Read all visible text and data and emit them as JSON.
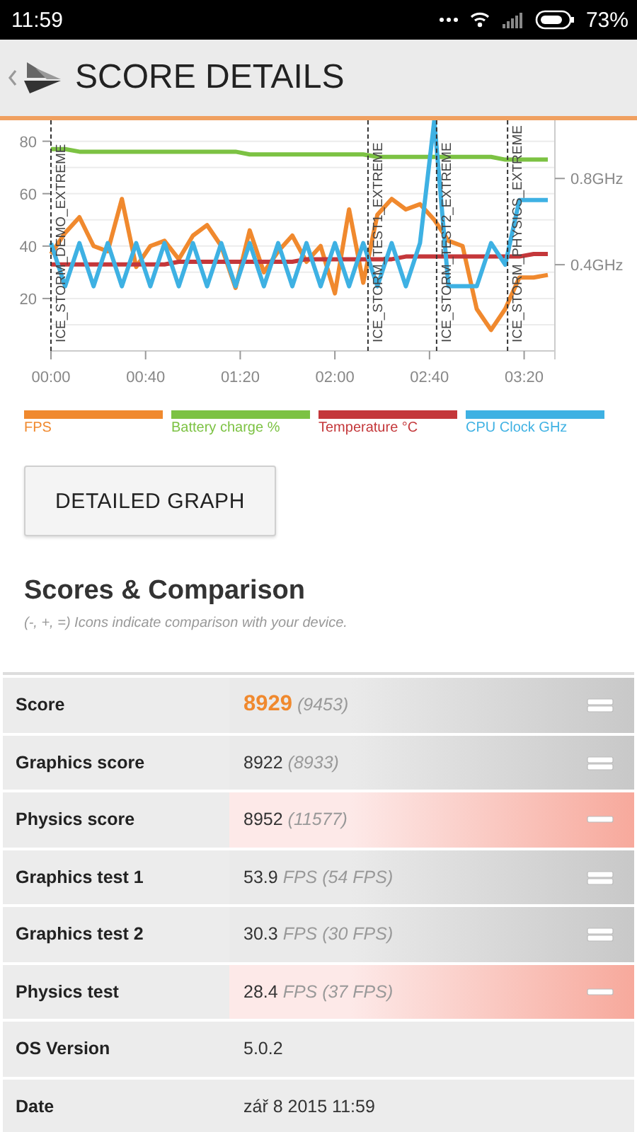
{
  "status_bar": {
    "time": "11:59",
    "battery": "73%"
  },
  "header": {
    "title": "SCORE DETAILS"
  },
  "chart": {
    "chart_data": {
      "type": "line",
      "x": [
        0,
        6,
        12,
        18,
        24,
        30,
        36,
        42,
        48,
        54,
        60,
        66,
        72,
        78,
        84,
        90,
        96,
        102,
        108,
        114,
        120,
        126,
        132,
        138,
        144,
        150,
        156,
        162,
        168,
        174,
        180,
        186,
        192,
        198,
        204,
        210
      ],
      "xticks": [
        {
          "value": 0,
          "label": "00:00"
        },
        {
          "value": 40,
          "label": "00:40"
        },
        {
          "value": 80,
          "label": "01:20"
        },
        {
          "value": 120,
          "label": "02:00"
        },
        {
          "value": 160,
          "label": "02:40"
        },
        {
          "value": 200,
          "label": "03:20"
        }
      ],
      "xlim": [
        0,
        213
      ],
      "ylim": [
        0,
        88
      ],
      "yticks": [
        20,
        40,
        60,
        80
      ],
      "grid": true,
      "y2lim": [
        0,
        1.07
      ],
      "y2ticks": [
        {
          "value": 0.4,
          "label": "0.4GHz"
        },
        {
          "value": 0.8,
          "label": "0.8GHz"
        }
      ],
      "series": [
        {
          "name": "FPS",
          "color": "#f0892e",
          "values": [
            37,
            45,
            51,
            40,
            38,
            58,
            32,
            40,
            42,
            35,
            44,
            48,
            40,
            24,
            46,
            30,
            38,
            44,
            34,
            40,
            22,
            54,
            26,
            52,
            58,
            54,
            56,
            50,
            42,
            40,
            16,
            8,
            16,
            28,
            28,
            29
          ]
        },
        {
          "name": "Battery charge %",
          "color": "#7cc243",
          "values": [
            77,
            77,
            76,
            76,
            76,
            76,
            76,
            76,
            76,
            76,
            76,
            76,
            76,
            76,
            75,
            75,
            75,
            75,
            75,
            75,
            75,
            75,
            75,
            74,
            74,
            74,
            74,
            74,
            74,
            74,
            74,
            74,
            73,
            73,
            73,
            73
          ]
        },
        {
          "name": "Temperature °C",
          "color": "#c4373a",
          "values": [
            33,
            33,
            33,
            33,
            33,
            33,
            33,
            33,
            33,
            34,
            34,
            34,
            34,
            34,
            34,
            34,
            34,
            34,
            35,
            35,
            35,
            35,
            35,
            35,
            35,
            36,
            36,
            36,
            36,
            36,
            36,
            36,
            36,
            36,
            37,
            37
          ]
        },
        {
          "name": "CPU Clock GHz",
          "color": "#3eb1e3",
          "axis": "y2",
          "values": [
            0.5,
            0.3,
            0.5,
            0.3,
            0.5,
            0.3,
            0.5,
            0.3,
            0.5,
            0.3,
            0.5,
            0.3,
            0.5,
            0.3,
            0.5,
            0.3,
            0.5,
            0.3,
            0.5,
            0.3,
            0.5,
            0.3,
            0.5,
            0.3,
            0.5,
            0.3,
            0.5,
            1.07,
            0.3,
            0.3,
            0.3,
            0.5,
            0.4,
            0.7,
            0.7,
            0.7
          ]
        }
      ],
      "annotations": [
        {
          "x": 0,
          "text": "ICE_STORM_DEMO_EXTREME"
        },
        {
          "x": 134,
          "text": "ICE_STORM_TEST1_EXTREME"
        },
        {
          "x": 163,
          "text": "ICE_STORM_TEST2_EXTREME"
        },
        {
          "x": 193,
          "text": "ICE_STORM_PHYSICS_EXTREME"
        }
      ]
    }
  },
  "detail_button": {
    "label": "DETAILED GRAPH"
  },
  "scores_section": {
    "title": "Scores & Comparison",
    "subtitle": "(-, +, =) Icons indicate comparison with your device."
  },
  "rows": [
    {
      "kind": "score",
      "label": "Score",
      "value": "8929",
      "detail": "(9453)",
      "highlight": true,
      "worse": false
    },
    {
      "kind": "score",
      "label": "Graphics score",
      "value": "8922",
      "detail": "(8933)",
      "highlight": false,
      "worse": false
    },
    {
      "kind": "score",
      "label": "Physics score",
      "value": "8952",
      "detail": "(11577)",
      "highlight": false,
      "worse": true
    },
    {
      "kind": "score",
      "label": "Graphics test 1",
      "value": "53.9",
      "detail": "FPS (54 FPS)",
      "highlight": false,
      "worse": false
    },
    {
      "kind": "score",
      "label": "Graphics test 2",
      "value": "30.3",
      "detail": "FPS (30 FPS)",
      "highlight": false,
      "worse": false
    },
    {
      "kind": "score",
      "label": "Physics test",
      "value": "28.4",
      "detail": "FPS (37 FPS)",
      "highlight": false,
      "worse": true
    },
    {
      "kind": "info",
      "label": "OS Version",
      "value": "5.0.2"
    },
    {
      "kind": "info",
      "label": "Date",
      "value": "zář 8 2015 11:59"
    }
  ]
}
